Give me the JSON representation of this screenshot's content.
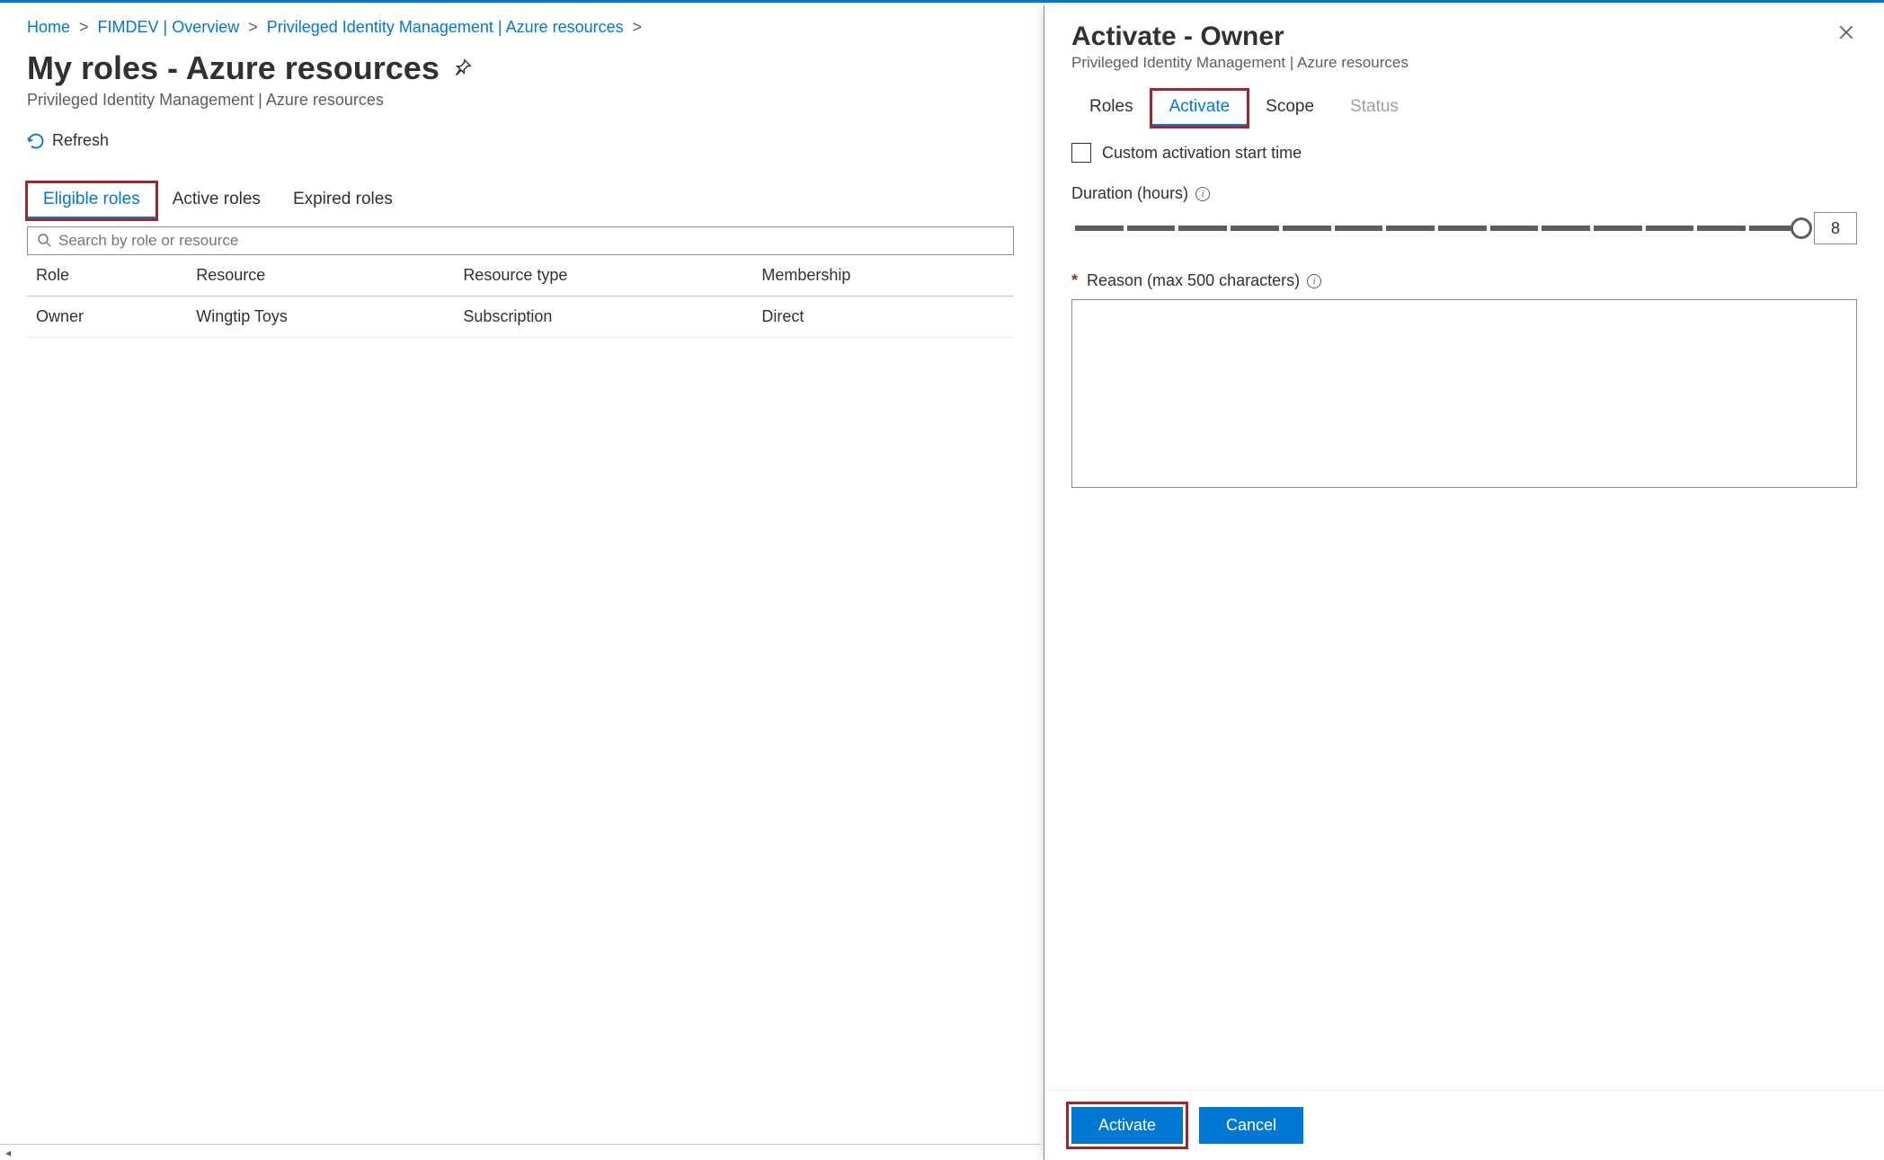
{
  "breadcrumb": {
    "home": "Home",
    "item1": "FIMDEV | Overview",
    "item2": "Privileged Identity Management | Azure resources"
  },
  "page": {
    "title": "My roles - Azure resources",
    "subtitle": "Privileged Identity Management | Azure resources",
    "refresh_label": "Refresh"
  },
  "tabs": {
    "eligible": "Eligible roles",
    "active": "Active roles",
    "expired": "Expired roles"
  },
  "search": {
    "placeholder": "Search by role or resource"
  },
  "table": {
    "headers": {
      "role": "Role",
      "resource": "Resource",
      "resource_type": "Resource type",
      "membership": "Membership"
    },
    "rows": [
      {
        "role": "Owner",
        "resource": "Wingtip Toys",
        "resource_type": "Subscription",
        "membership": "Direct"
      }
    ]
  },
  "panel": {
    "title": "Activate - Owner",
    "subtitle": "Privileged Identity Management | Azure resources",
    "tabs": {
      "roles": "Roles",
      "activate": "Activate",
      "scope": "Scope",
      "status": "Status"
    },
    "custom_start_label": "Custom activation start time",
    "duration_label": "Duration (hours)",
    "duration_value": "8",
    "reason_label": "Reason (max 500 characters)",
    "activate_btn": "Activate",
    "cancel_btn": "Cancel"
  },
  "colors": {
    "link": "#0078d4",
    "highlight": "#a4262c"
  }
}
